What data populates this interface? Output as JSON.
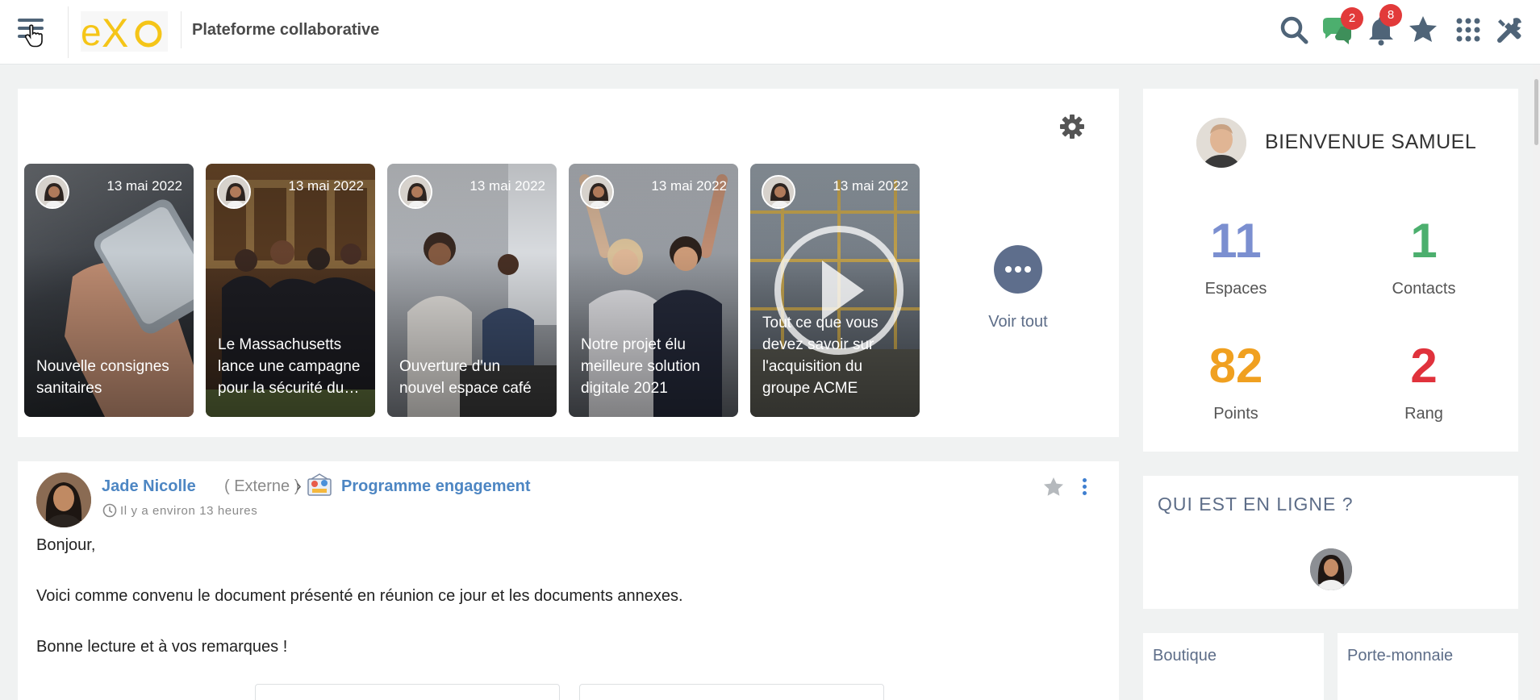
{
  "topbar": {
    "title": "Plateforme collaborative",
    "logo_text": "eXo",
    "chat_badge": "2",
    "notifications_badge": "8",
    "colors": {
      "icon": "#4f6478",
      "badge": "#e23a3a",
      "logo_yellow": "#f5c518"
    },
    "icons": [
      "hamburger-icon",
      "search-icon",
      "chat-icon",
      "bell-icon",
      "star-icon",
      "apps-grid-icon",
      "admin-tools-icon"
    ]
  },
  "stories": {
    "items": [
      {
        "date": "13 mai 2022",
        "title": "Nouvelle consignes sanitaires"
      },
      {
        "date": "13 mai 2022",
        "title": "Le Massachusetts lance une campagne pour la sécurité du…"
      },
      {
        "date": "13 mai 2022",
        "title": "Ouverture d'un nouvel espace café"
      },
      {
        "date": "13 mai 2022",
        "title": "Notre projet élu meilleure solution digitale 2021"
      },
      {
        "date": "13 mai 2022",
        "title": "Tout ce que vous devez savoir sur l'acquisition du groupe ACME"
      }
    ],
    "see_all": "Voir tout"
  },
  "welcome": {
    "greeting": "BIENVENUE SAMUEL",
    "stats": [
      {
        "value": "11",
        "label": "Espaces",
        "color": "#7b8fd0"
      },
      {
        "value": "1",
        "label": "Contacts",
        "color": "#4caf6e"
      },
      {
        "value": "82",
        "label": "Points",
        "color": "#f0a020"
      },
      {
        "value": "2",
        "label": "Rang",
        "color": "#e0323c"
      }
    ]
  },
  "online": {
    "title": "QUI EST EN LIGNE ?"
  },
  "widgets": {
    "boutique": "Boutique",
    "wallet": "Porte-monnaie"
  },
  "post": {
    "author": "Jade Nicolle",
    "role": "( Externe )",
    "separator": "›",
    "space": "Programme engagement",
    "time": "Il y a environ 13 heures",
    "paragraphs": [
      "Bonjour,",
      "Voici comme convenu le document présenté en réunion ce jour et les documents annexes.",
      "Bonne lecture et à vos remarques !"
    ]
  }
}
